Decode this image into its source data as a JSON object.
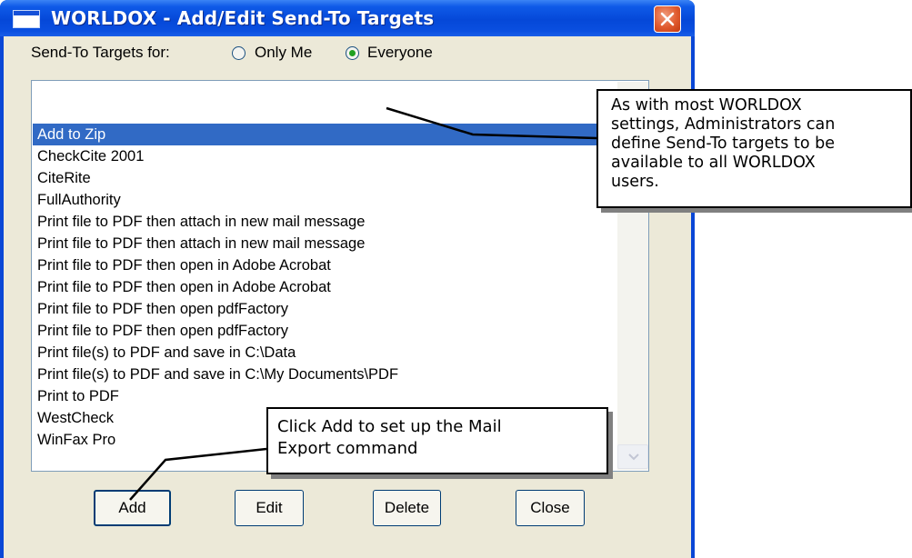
{
  "window": {
    "title": "WORLDOX - Add/Edit Send-To Targets"
  },
  "targets_for": {
    "label": "Send-To Targets for:",
    "options": [
      {
        "label": "Only Me",
        "selected": false
      },
      {
        "label": "Everyone",
        "selected": true
      }
    ]
  },
  "targets_list": {
    "items": [
      {
        "label": "Add to Zip",
        "selected": true
      },
      {
        "label": "CheckCite 2001",
        "selected": false
      },
      {
        "label": "CiteRite",
        "selected": false
      },
      {
        "label": "FullAuthority",
        "selected": false
      },
      {
        "label": "Print file to PDF then attach in new mail message",
        "selected": false
      },
      {
        "label": "Print file to PDF then attach in new mail message",
        "selected": false
      },
      {
        "label": "Print file to PDF then open in Adobe Acrobat",
        "selected": false
      },
      {
        "label": "Print file to PDF then open in Adobe Acrobat",
        "selected": false
      },
      {
        "label": "Print file to PDF then open pdfFactory",
        "selected": false
      },
      {
        "label": "Print file to PDF then open pdfFactory",
        "selected": false
      },
      {
        "label": "Print file(s) to PDF and save in C:\\Data",
        "selected": false
      },
      {
        "label": "Print file(s) to PDF and save in C:\\My Documents\\PDF",
        "selected": false
      },
      {
        "label": "Print to PDF",
        "selected": false
      },
      {
        "label": "WestCheck",
        "selected": false
      },
      {
        "label": "WinFax Pro",
        "selected": false
      }
    ]
  },
  "buttons": {
    "add": "Add",
    "edit": "Edit",
    "delete": "Delete",
    "close": "Close"
  },
  "callouts": {
    "admin_note": "As with most WORLDOX\nsettings, Administrators can\ndefine Send-To targets to be\navailable to all WORLDOX\nusers.",
    "add_note": "Click Add to set up  the Mail\nExport command"
  },
  "colors": {
    "titlebar": "#0548d8",
    "dialog_face": "#ece9d8",
    "selection": "#316ac5",
    "close_button": "#e05a2e"
  },
  "icons": {
    "window": "window-icon",
    "close": "close-icon",
    "scroll_down": "chevron-down-icon"
  }
}
